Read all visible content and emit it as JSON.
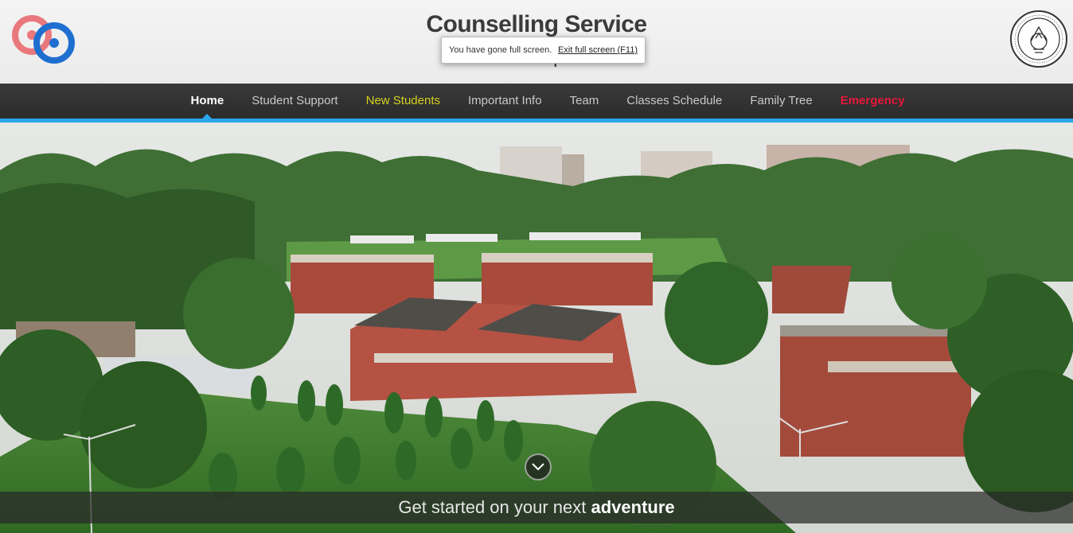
{
  "header": {
    "title": "Counselling Service",
    "subtitle": "IIT Kanpur"
  },
  "fullscreen_notice": {
    "message": "You have gone full screen.",
    "exit_label": "Exit full screen (F11)"
  },
  "nav": {
    "items": [
      {
        "label": "Home"
      },
      {
        "label": "Student Support"
      },
      {
        "label": "New Students"
      },
      {
        "label": "Important Info"
      },
      {
        "label": "Team"
      },
      {
        "label": "Classes Schedule"
      },
      {
        "label": "Family Tree"
      },
      {
        "label": "Emergency"
      }
    ],
    "active": "Home"
  },
  "hero": {
    "tagline_prefix": "Get started on your next",
    "tagline_bold": "adventure",
    "scroll_icon": "chevron-down-icon"
  },
  "colors": {
    "accent": "#2aa7e8",
    "nav_bg": "#2f2f2f",
    "new_students": "#d7d21f",
    "emergency": "#e8183a",
    "logo_red": "#e9787d",
    "logo_blue": "#1f6fd1"
  }
}
